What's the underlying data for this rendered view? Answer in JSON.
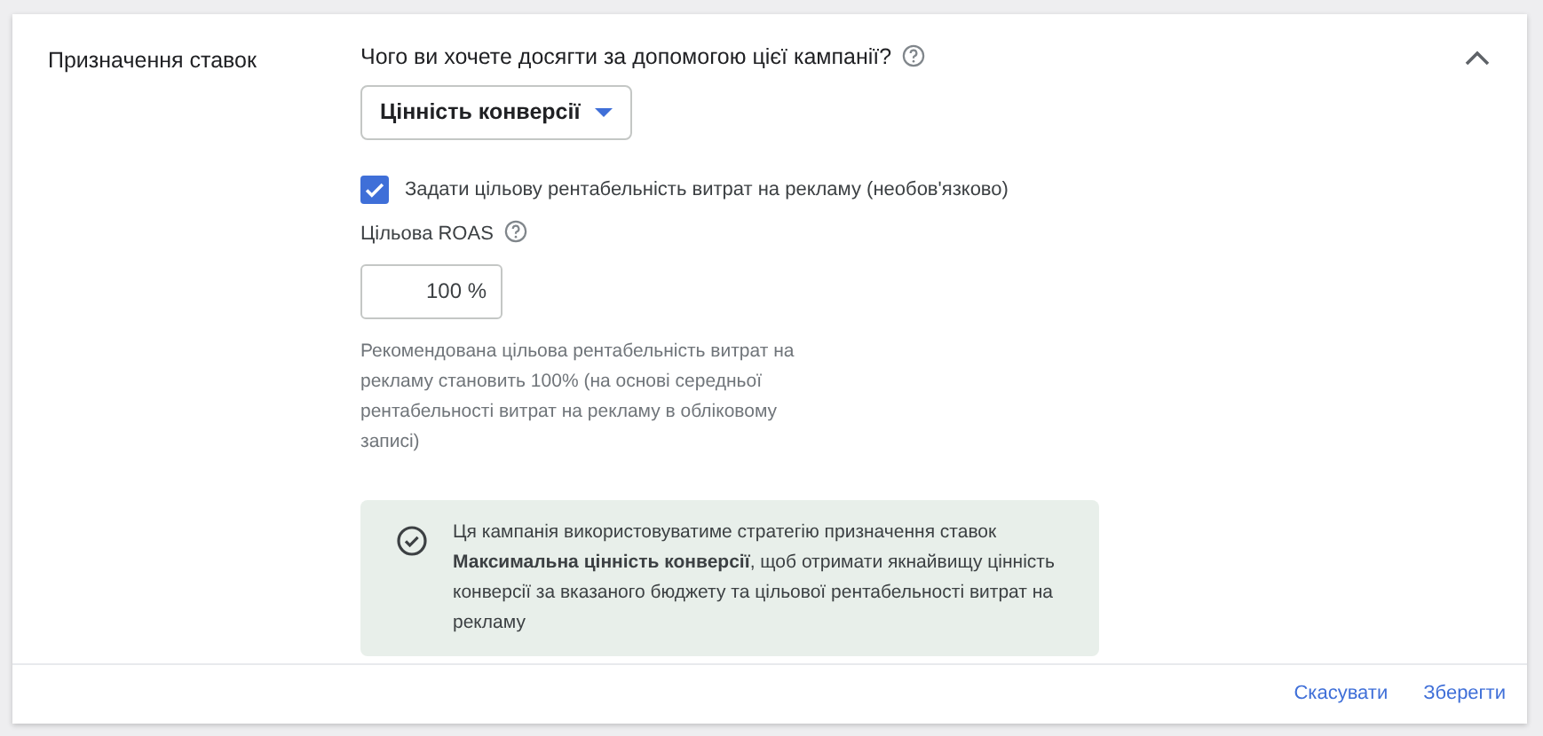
{
  "section": {
    "title": "Призначення ставок",
    "expanded": true
  },
  "question": {
    "label": "Чого ви хочете досягти за допомогою цієї кампанії?"
  },
  "goal_dropdown": {
    "value": "Цінність конверсії"
  },
  "target_checkbox": {
    "label": "Задати цільову рентабельність витрат на рекламу (необов'язково)",
    "checked": true
  },
  "roas_field": {
    "label": "Цільова ROAS",
    "value": "100",
    "suffix": "%"
  },
  "recommendation": "Рекомендована цільова рентабельність витрат на рекламу становить 100% (на основі середньої рентабельності витрат на рекламу в обліковому записі)",
  "info_box": {
    "text": "Ця кампанія використовуватиме стратегію призначення ставок **Максимальна цінність конверсії**, щоб отримати якнайвищу цінність конверсії за вказаного бюджету та цільової рентабельності витрат на рекламу"
  },
  "buttons": [
    "Скасувати",
    "Зберегти"
  ]
}
